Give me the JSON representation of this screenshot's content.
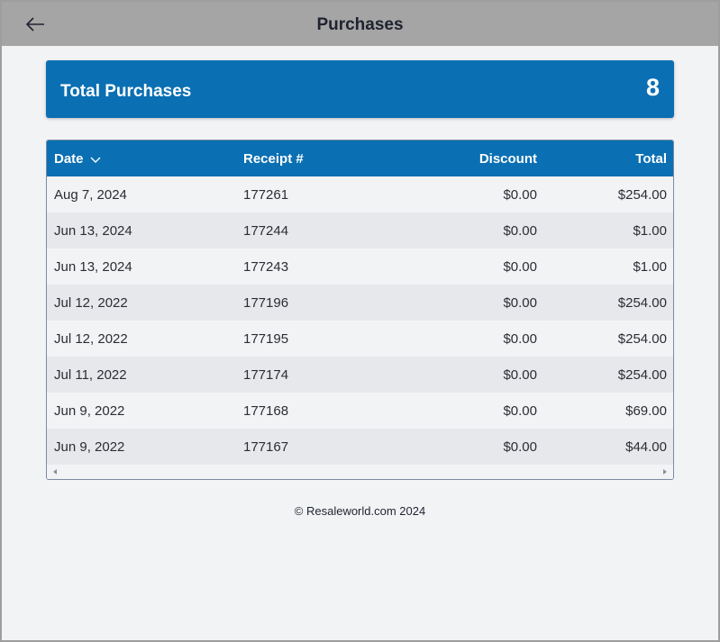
{
  "header": {
    "title": "Purchases",
    "back_icon": "arrow-left-icon"
  },
  "summary": {
    "label": "Total Purchases",
    "value": "8"
  },
  "table": {
    "columns": {
      "date": "Date",
      "receipt": "Receipt #",
      "discount": "Discount",
      "total": "Total"
    },
    "sort_icon": "chevron-down-icon",
    "rows": [
      {
        "date": "Aug 7, 2024",
        "receipt": "177261",
        "discount": "$0.00",
        "total": "$254.00"
      },
      {
        "date": "Jun 13, 2024",
        "receipt": "177244",
        "discount": "$0.00",
        "total": "$1.00"
      },
      {
        "date": "Jun 13, 2024",
        "receipt": "177243",
        "discount": "$0.00",
        "total": "$1.00"
      },
      {
        "date": "Jul 12, 2022",
        "receipt": "177196",
        "discount": "$0.00",
        "total": "$254.00"
      },
      {
        "date": "Jul 12, 2022",
        "receipt": "177195",
        "discount": "$0.00",
        "total": "$254.00"
      },
      {
        "date": "Jul 11, 2022",
        "receipt": "177174",
        "discount": "$0.00",
        "total": "$254.00"
      },
      {
        "date": "Jun 9, 2022",
        "receipt": "177168",
        "discount": "$0.00",
        "total": "$69.00"
      },
      {
        "date": "Jun 9, 2022",
        "receipt": "177167",
        "discount": "$0.00",
        "total": "$44.00"
      }
    ]
  },
  "footer": {
    "text": "© Resaleworld.com 2024"
  },
  "colors": {
    "accent": "#0a6fb3",
    "topbar": "#a5a5a5",
    "background": "#f2f3f5",
    "row_alt": "#e6e8eb"
  }
}
